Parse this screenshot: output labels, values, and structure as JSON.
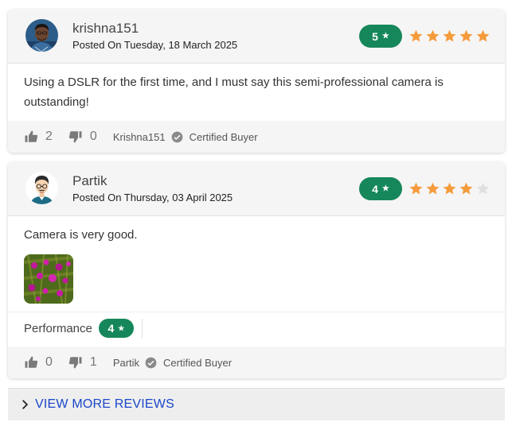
{
  "colors": {
    "rating_green": "#16875a",
    "star_filled": "#f59b3c",
    "star_empty": "#e0e0e0",
    "link_blue": "#1a47c9"
  },
  "reviews": [
    {
      "user_name": "krishna151",
      "posted": "Posted On Tuesday, 18 March 2025",
      "rating": "5",
      "rating_value": 5,
      "max_rating": 5,
      "text": "Using a DSLR for the first time, and I must say this semi-professional camera is outstanding!",
      "likes": "2",
      "dislikes": "0",
      "reviewer": "Krishna151",
      "buyer_label": "Certified Buyer",
      "avatar_icon": "user-photo-avatar"
    },
    {
      "user_name": "Partik",
      "posted": "Posted On Thursday, 03 April 2025",
      "rating": "4",
      "rating_value": 4,
      "max_rating": 5,
      "text": "Camera is very good.",
      "performance_label": "Performance",
      "performance_rating": "4",
      "likes": "0",
      "dislikes": "1",
      "reviewer": "Partik",
      "buyer_label": "Certified Buyer",
      "avatar_icon": "cartoon-avatar",
      "image_icon": "flower-photo-thumbnail"
    }
  ],
  "view_more_label": "VIEW MORE REVIEWS"
}
